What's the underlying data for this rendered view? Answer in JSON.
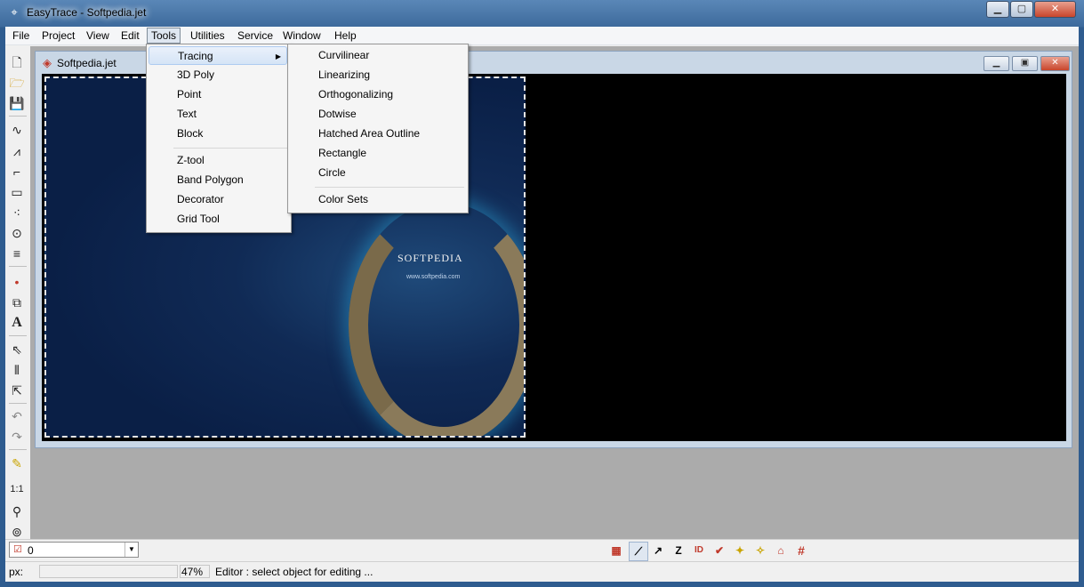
{
  "window": {
    "title": "EasyTrace - Softpedia.jet",
    "icon": "easytrace-app-icon"
  },
  "menubar": [
    "File",
    "Project",
    "View",
    "Edit",
    "Tools",
    "Utilities",
    "Service",
    "Window",
    "Help"
  ],
  "tools_menu": {
    "group1": [
      "Tracing",
      "3D Poly",
      "Point",
      "Text",
      "Block"
    ],
    "group2": [
      "Z-tool",
      "Band Polygon",
      "Decorator",
      "Grid Tool"
    ]
  },
  "tracing_submenu": {
    "items": [
      "Curvilinear",
      "Linearizing",
      "Orthogonalizing",
      "Dotwise",
      "Hatched Area Outline",
      "Rectangle",
      "Circle"
    ],
    "extra": "Color Sets"
  },
  "document": {
    "title": "Softpedia.jet",
    "watermark": "SOFTPEDIA",
    "watermark_url": "www.softpedia.com"
  },
  "layer_combo": {
    "value": "0"
  },
  "status": {
    "px_label": "px:",
    "zoom": "47%",
    "message": "Editor : select object for editing ..."
  },
  "left_tools": [
    "new-file-icon",
    "open-folder-icon",
    "save-icon",
    "curve-icon",
    "polyline-icon",
    "step-line-icon",
    "rectangle-icon",
    "dotted-curve-icon",
    "circle-icon",
    "hatch-icon",
    "point-icon",
    "block-icon",
    "text-icon",
    "select-arrow-icon",
    "multi-select-icon",
    "select-node-icon",
    "undo-icon",
    "redo-icon",
    "pencil-icon",
    "scale-1to1-icon",
    "zoom-icon",
    "zoom-fit-icon"
  ],
  "left_tool_glyphs": {
    "text-icon": "A",
    "scale-1to1-icon": "1:1"
  },
  "bottom_tools": [
    "attributes-icon",
    "snap-icon",
    "arrow-icon",
    "z-value-icon",
    "id-icon",
    "check-icon",
    "wand-icon",
    "wand2-icon",
    "house-icon",
    "grid-hash-icon"
  ],
  "bottom_glyphs": {
    "z-value-icon": "Z",
    "id-icon": "ID",
    "grid-hash-icon": "#"
  }
}
